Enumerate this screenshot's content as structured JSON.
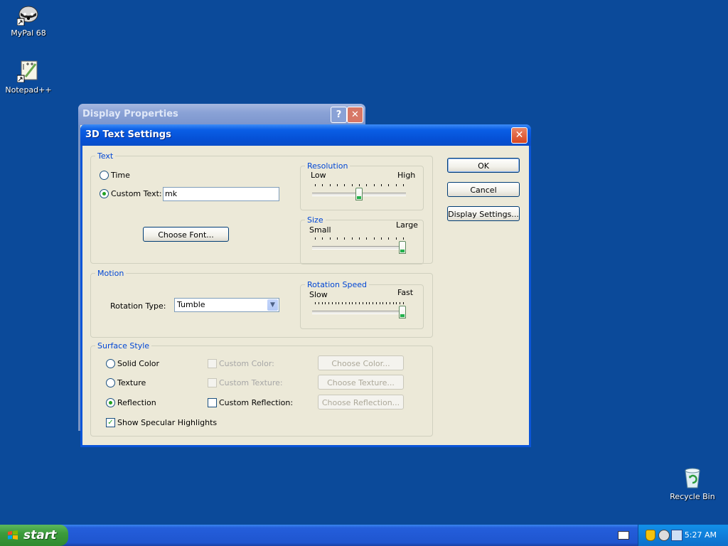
{
  "desktop": {
    "icons": [
      {
        "label": "MyPal 68"
      },
      {
        "label": "Notepad++"
      },
      {
        "label": "Recycle Bin"
      }
    ]
  },
  "back_window": {
    "title": "Display Properties",
    "help": "?",
    "close": "✕"
  },
  "dialog": {
    "title": "3D Text Settings",
    "close": "✕",
    "text_group": {
      "legend": "Text",
      "time_label": "Time",
      "custom_text_label": "Custom Text:",
      "custom_text_value": "mk",
      "selected": "Custom Text",
      "choose_font": "Choose Font..."
    },
    "resolution": {
      "legend": "Resolution",
      "low": "Low",
      "high": "High",
      "value": 0.5
    },
    "size": {
      "legend": "Size",
      "small": "Small",
      "large": "Large",
      "value": 1.0
    },
    "motion": {
      "legend": "Motion",
      "rotation_type_label": "Rotation Type:",
      "rotation_type_value": "Tumble"
    },
    "rotation_speed": {
      "legend": "Rotation Speed",
      "slow": "Slow",
      "fast": "Fast",
      "value": 1.0
    },
    "surface": {
      "legend": "Surface Style",
      "solid_color": "Solid Color",
      "texture": "Texture",
      "reflection": "Reflection",
      "selected": "Reflection",
      "custom_color": "Custom Color:",
      "custom_texture": "Custom Texture:",
      "custom_reflection": "Custom Reflection:",
      "choose_color": "Choose Color...",
      "choose_texture": "Choose Texture...",
      "choose_reflection": "Choose Reflection...",
      "show_specular": "Show Specular Highlights",
      "show_specular_checked": true
    },
    "buttons": {
      "ok": "OK",
      "cancel": "Cancel",
      "display_settings": "Display Settings..."
    }
  },
  "taskbar": {
    "start": "start",
    "clock": "5:27 AM"
  },
  "colors": {
    "desktop": "#0b4a9a",
    "title_blue": "#0a55d8",
    "dialog_face": "#ece9d8",
    "group_legend": "#0046d5",
    "accent_green": "#21a121"
  }
}
